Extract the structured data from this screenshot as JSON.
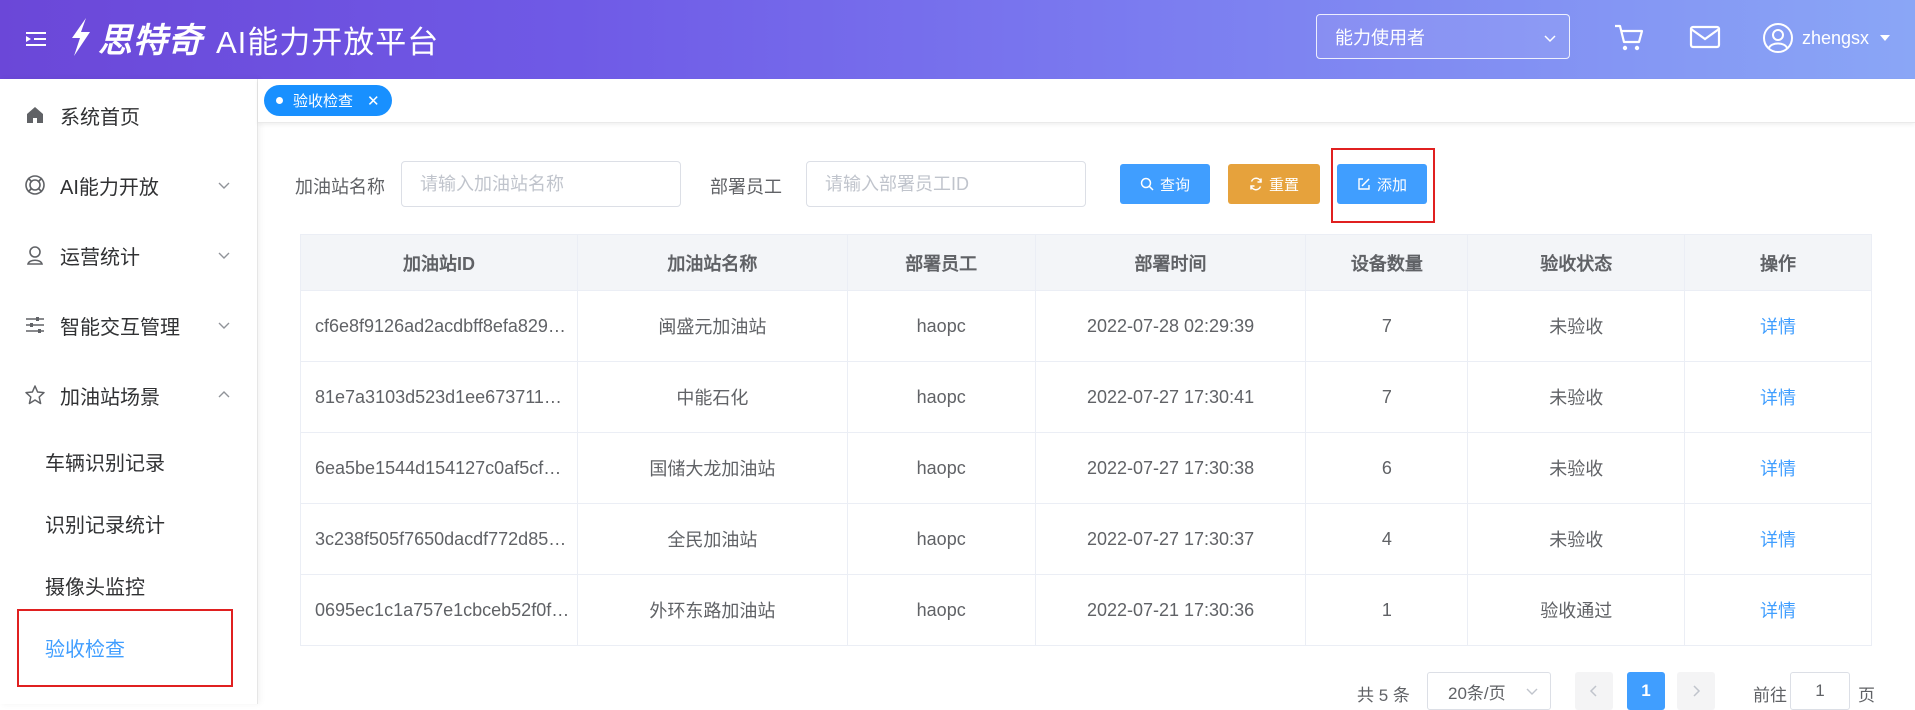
{
  "header": {
    "logo_text": "思特奇",
    "app_title": "AI能力开放平台",
    "role": "能力使用者",
    "username": "zhengsx"
  },
  "sidebar": {
    "items": [
      {
        "label": "系统首页",
        "icon": "home-icon"
      },
      {
        "label": "AI能力开放",
        "icon": "radar-icon"
      },
      {
        "label": "运营统计",
        "icon": "user-pin-icon"
      },
      {
        "label": "智能交互管理",
        "icon": "sliders-icon"
      },
      {
        "label": "加油站场景",
        "icon": "star-icon"
      }
    ],
    "sub_items": [
      "车辆识别记录",
      "识别记录统计",
      "摄像头监控",
      "验收检查"
    ]
  },
  "tabs": [
    {
      "label": "验收检查"
    }
  ],
  "filter": {
    "station_label": "加油站名称",
    "station_placeholder": "请输入加油站名称",
    "staff_label": "部署员工",
    "staff_placeholder": "请输入部署员工ID",
    "query": "查询",
    "reset": "重置",
    "add": "添加"
  },
  "table": {
    "headers": [
      "加油站ID",
      "加油站名称",
      "部署员工",
      "部署时间",
      "设备数量",
      "验收状态",
      "操作"
    ],
    "rows": [
      {
        "id": "cf6e8f9126ad2acdbff8efa829…",
        "name": "闽盛元加油站",
        "staff": "haopc",
        "time": "2022-07-28 02:29:39",
        "count": "7",
        "status": "未验收",
        "action": "详情"
      },
      {
        "id": "81e7a3103d523d1ee673711…",
        "name": "中能石化",
        "staff": "haopc",
        "time": "2022-07-27 17:30:41",
        "count": "7",
        "status": "未验收",
        "action": "详情"
      },
      {
        "id": "6ea5be1544d154127c0af5cf…",
        "name": "国储大龙加油站",
        "staff": "haopc",
        "time": "2022-07-27 17:30:38",
        "count": "6",
        "status": "未验收",
        "action": "详情"
      },
      {
        "id": "3c238f505f7650dacdf772d85…",
        "name": "全民加油站",
        "staff": "haopc",
        "time": "2022-07-27 17:30:37",
        "count": "4",
        "status": "未验收",
        "action": "详情"
      },
      {
        "id": "0695ec1c1a757e1cbceb52f0f…",
        "name": "外环东路加油站",
        "staff": "haopc",
        "time": "2022-07-21 17:30:36",
        "count": "1",
        "status": "验收通过",
        "action": "详情"
      }
    ]
  },
  "pagination": {
    "total": "共 5 条",
    "page_size": "20条/页",
    "current": "1",
    "goto_prefix": "前往",
    "goto_value": "1",
    "goto_suffix": "页"
  },
  "colors": {
    "primary": "#409eff",
    "warning": "#e6a23c",
    "success": "#3a9b1c",
    "highlight": "#e02020"
  }
}
